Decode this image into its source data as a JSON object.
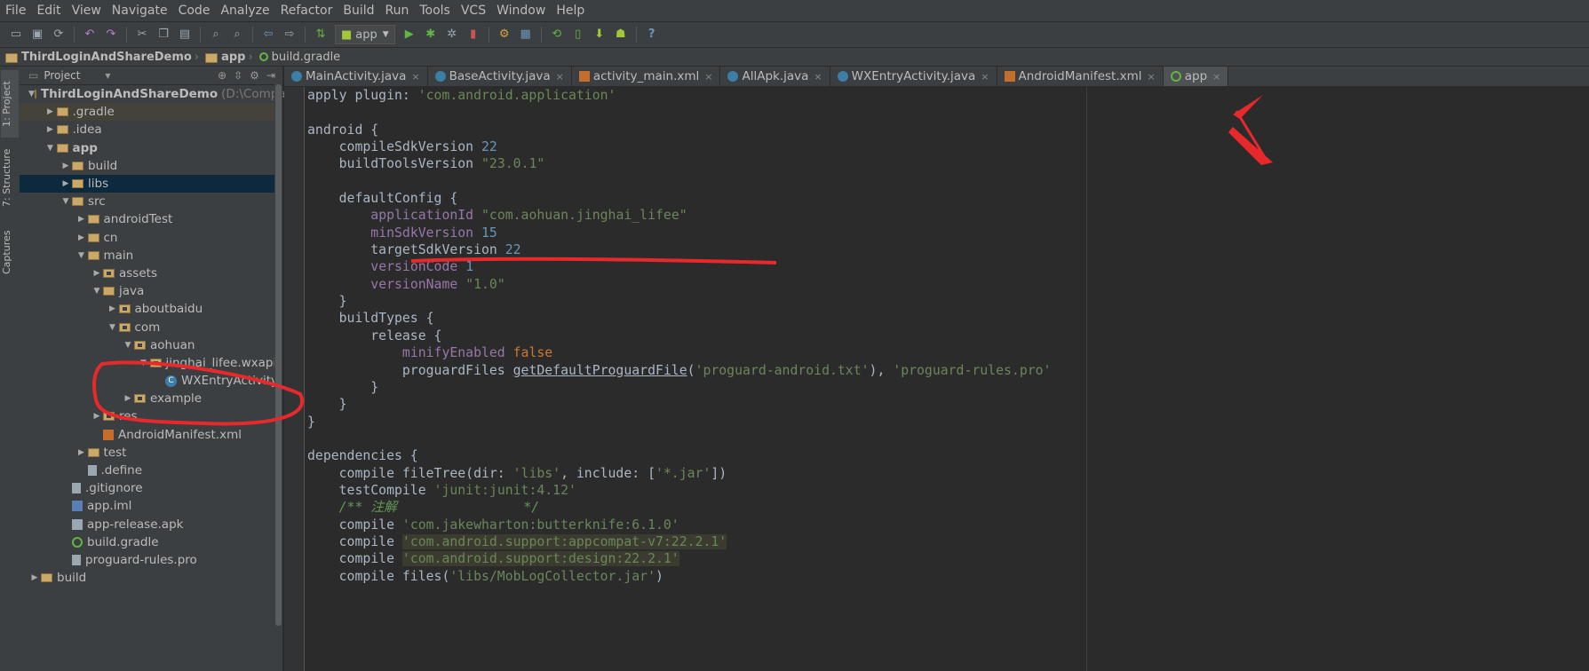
{
  "menubar": {
    "items": [
      "File",
      "Edit",
      "View",
      "Navigate",
      "Code",
      "Analyze",
      "Refactor",
      "Build",
      "Run",
      "Tools",
      "VCS",
      "Window",
      "Help"
    ]
  },
  "toolbar": {
    "run_config": "app",
    "help_label": "?"
  },
  "breadcrumb": {
    "items": [
      "ThirdLoginAndShareDemo",
      "app",
      "build.gradle"
    ]
  },
  "side_tabs": {
    "project": "1: Project",
    "structure": "7: Structure",
    "captures": "Captures"
  },
  "project_panel": {
    "header": "Project",
    "tree": [
      {
        "label": "ThirdLoginAndShareDemo",
        "extra": "(D:\\Company\\A",
        "depth": 0,
        "expanded": true,
        "icon": "folder",
        "bold": true
      },
      {
        "label": ".gradle",
        "depth": 1,
        "expanded": false,
        "icon": "folder",
        "highlight": true
      },
      {
        "label": ".idea",
        "depth": 1,
        "expanded": false,
        "icon": "folder"
      },
      {
        "label": "app",
        "depth": 1,
        "expanded": true,
        "icon": "folder",
        "bold": true
      },
      {
        "label": "build",
        "depth": 2,
        "expanded": false,
        "icon": "folder"
      },
      {
        "label": "libs",
        "depth": 2,
        "expanded": false,
        "icon": "folder",
        "selected": true
      },
      {
        "label": "src",
        "depth": 2,
        "expanded": true,
        "icon": "folder"
      },
      {
        "label": "androidTest",
        "depth": 3,
        "expanded": false,
        "icon": "folder"
      },
      {
        "label": "cn",
        "depth": 3,
        "expanded": false,
        "icon": "folder"
      },
      {
        "label": "main",
        "depth": 3,
        "expanded": true,
        "icon": "folder"
      },
      {
        "label": "assets",
        "depth": 4,
        "expanded": false,
        "icon": "package"
      },
      {
        "label": "java",
        "depth": 4,
        "expanded": true,
        "icon": "folder"
      },
      {
        "label": "aboutbaidu",
        "depth": 5,
        "expanded": false,
        "icon": "package"
      },
      {
        "label": "com",
        "depth": 5,
        "expanded": true,
        "icon": "package"
      },
      {
        "label": "aohuan",
        "depth": 6,
        "expanded": true,
        "icon": "package"
      },
      {
        "label": "jinghai_lifee.wxapi",
        "depth": 7,
        "expanded": true,
        "icon": "package"
      },
      {
        "label": "WXEntryActivity",
        "depth": 8,
        "expanded": null,
        "icon": "class"
      },
      {
        "label": "example",
        "depth": 6,
        "expanded": false,
        "icon": "package"
      },
      {
        "label": "res",
        "depth": 4,
        "expanded": false,
        "icon": "package"
      },
      {
        "label": "AndroidManifest.xml",
        "depth": 4,
        "expanded": null,
        "icon": "xml"
      },
      {
        "label": "test",
        "depth": 3,
        "expanded": false,
        "icon": "folder"
      },
      {
        "label": ".define",
        "depth": 3,
        "expanded": null,
        "icon": "file"
      },
      {
        "label": ".gitignore",
        "depth": 2,
        "expanded": null,
        "icon": "file"
      },
      {
        "label": "app.iml",
        "depth": 2,
        "expanded": null,
        "icon": "iml"
      },
      {
        "label": "app-release.apk",
        "depth": 2,
        "expanded": null,
        "icon": "apk"
      },
      {
        "label": "build.gradle",
        "depth": 2,
        "expanded": null,
        "icon": "gradle"
      },
      {
        "label": "proguard-rules.pro",
        "depth": 2,
        "expanded": null,
        "icon": "file"
      },
      {
        "label": "build",
        "depth": 0,
        "expanded": false,
        "icon": "folder"
      }
    ]
  },
  "editor": {
    "tabs": [
      {
        "label": "MainActivity.java",
        "icon": "class",
        "active": false
      },
      {
        "label": "BaseActivity.java",
        "icon": "class",
        "active": false
      },
      {
        "label": "activity_main.xml",
        "icon": "xml",
        "active": false
      },
      {
        "label": "AllApk.java",
        "icon": "class",
        "active": false
      },
      {
        "label": "WXEntryActivity.java",
        "icon": "class",
        "active": false
      },
      {
        "label": "AndroidManifest.xml",
        "icon": "xml",
        "active": false
      },
      {
        "label": "app",
        "icon": "gradle",
        "active": true
      }
    ],
    "code_lines": [
      [
        [
          "plain",
          "apply plugin: "
        ],
        [
          "str",
          "'com.android.application'"
        ]
      ],
      [],
      [
        [
          "plain",
          "android {"
        ]
      ],
      [
        [
          "plain",
          "    compileSdkVersion "
        ],
        [
          "num",
          "22"
        ]
      ],
      [
        [
          "plain",
          "    buildToolsVersion "
        ],
        [
          "str",
          "\"23.0.1\""
        ]
      ],
      [],
      [
        [
          "plain",
          "    defaultConfig {"
        ]
      ],
      [
        [
          "plain",
          "        "
        ],
        [
          "prop",
          "applicationId"
        ],
        [
          "plain",
          " "
        ],
        [
          "str",
          "\"com.aohuan.jinghai_lifee\""
        ]
      ],
      [
        [
          "plain",
          "        "
        ],
        [
          "prop",
          "minSdkVersion"
        ],
        [
          "plain",
          " "
        ],
        [
          "num",
          "15"
        ]
      ],
      [
        [
          "plain",
          "        targetSdkVersion "
        ],
        [
          "num",
          "22"
        ]
      ],
      [
        [
          "plain",
          "        "
        ],
        [
          "prop",
          "versionCode"
        ],
        [
          "plain",
          " "
        ],
        [
          "num",
          "1"
        ]
      ],
      [
        [
          "plain",
          "        "
        ],
        [
          "prop",
          "versionName"
        ],
        [
          "plain",
          " "
        ],
        [
          "str",
          "\"1.0\""
        ]
      ],
      [
        [
          "plain",
          "    }"
        ]
      ],
      [
        [
          "plain",
          "    buildTypes {"
        ]
      ],
      [
        [
          "plain",
          "        release {"
        ]
      ],
      [
        [
          "plain",
          "            "
        ],
        [
          "prop",
          "minifyEnabled"
        ],
        [
          "plain",
          " "
        ],
        [
          "kw",
          "false"
        ]
      ],
      [
        [
          "plain",
          "            proguardFiles "
        ],
        [
          "fn",
          "getDefaultProguardFile"
        ],
        [
          "plain",
          "("
        ],
        [
          "str",
          "'proguard-android.txt'"
        ],
        [
          "plain",
          "), "
        ],
        [
          "str",
          "'proguard-rules.pro'"
        ]
      ],
      [
        [
          "plain",
          "        }"
        ]
      ],
      [
        [
          "plain",
          "    }"
        ]
      ],
      [
        [
          "plain",
          "}"
        ]
      ],
      [],
      [
        [
          "plain",
          "dependencies {"
        ]
      ],
      [
        [
          "plain",
          "    compile fileTree(dir: "
        ],
        [
          "str",
          "'libs'"
        ],
        [
          "plain",
          ", include: ["
        ],
        [
          "str",
          "'*.jar'"
        ],
        [
          "plain",
          "])"
        ]
      ],
      [
        [
          "plain",
          "    testCompile "
        ],
        [
          "str",
          "'junit:junit:4.12'"
        ]
      ],
      [
        [
          "cm",
          "    /** 注解                */"
        ]
      ],
      [
        [
          "plain",
          "    compile "
        ],
        [
          "str",
          "'com.jakewharton:butterknife:6.1.0'"
        ]
      ],
      [
        [
          "plain",
          "    compile "
        ],
        [
          "hl",
          "'com.android.support:appcompat-v7:22.2.1'"
        ]
      ],
      [
        [
          "plain",
          "    compile "
        ],
        [
          "hl",
          "'com.android.support:design:22.2.1'"
        ]
      ],
      [
        [
          "plain",
          "    compile files("
        ],
        [
          "str",
          "'libs/MobLogCollector.jar'"
        ],
        [
          "plain",
          ")"
        ]
      ]
    ]
  },
  "colors": {
    "annotation_red": "#e8292b",
    "background": "#2b2b2b",
    "panel": "#3c3f41"
  }
}
